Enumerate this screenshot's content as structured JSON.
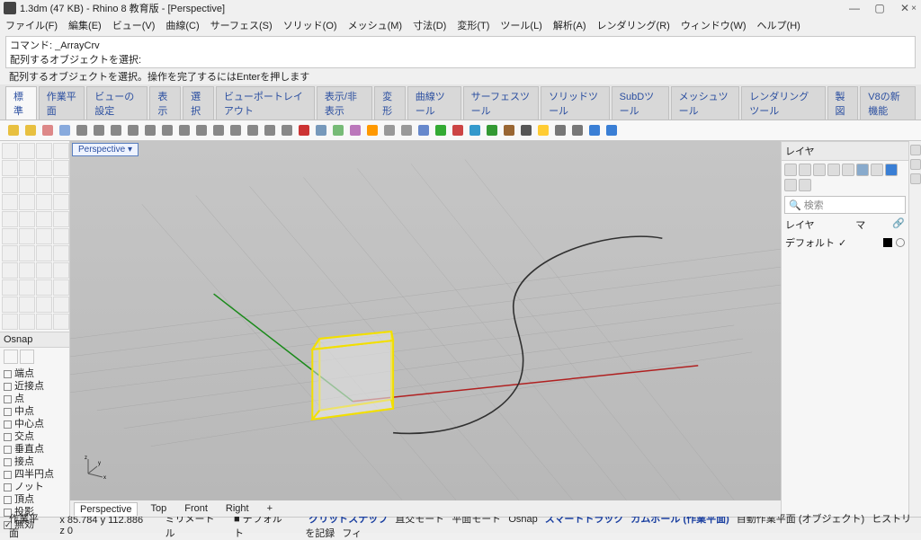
{
  "title": "1.3dm (47 KB) - Rhino 8 教育版 - [Perspective]",
  "menu": [
    "ファイル(F)",
    "編集(E)",
    "ビュー(V)",
    "曲線(C)",
    "サーフェス(S)",
    "ソリッド(O)",
    "メッシュ(M)",
    "寸法(D)",
    "変形(T)",
    "ツール(L)",
    "解析(A)",
    "レンダリング(R)",
    "ウィンドウ(W)",
    "ヘルプ(H)"
  ],
  "command_label": "コマンド:",
  "command_value": "_ArrayCrv",
  "history_line": "配列するオブジェクトを選択:",
  "prompt": "配列するオブジェクトを選択。操作を完了するにはEnterを押します",
  "ribbon_tabs": [
    "標準",
    "作業平面",
    "ビューの設定",
    "表示",
    "選択",
    "ビューポートレイアウト",
    "表示/非表示",
    "変形",
    "曲線ツール",
    "サーフェスツール",
    "ソリッドツール",
    "SubDツール",
    "メッシュツール",
    "レンダリングツール",
    "製図",
    "V8の新機能"
  ],
  "viewport_label": "Perspective ▾",
  "viewport_tabs": [
    "Perspective",
    "Top",
    "Front",
    "Right",
    "+"
  ],
  "osnap_title": "Osnap",
  "osnap": [
    {
      "label": "端点",
      "ck": false
    },
    {
      "label": "近接点",
      "ck": false
    },
    {
      "label": "点",
      "ck": false
    },
    {
      "label": "中点",
      "ck": false
    },
    {
      "label": "中心点",
      "ck": false
    },
    {
      "label": "交点",
      "ck": false
    },
    {
      "label": "垂直点",
      "ck": false
    },
    {
      "label": "接点",
      "ck": false
    },
    {
      "label": "四半円点",
      "ck": false
    },
    {
      "label": "ノット",
      "ck": false
    },
    {
      "label": "頂点",
      "ck": false
    },
    {
      "label": "投影",
      "ck": false
    },
    {
      "label": "無効",
      "ck": true
    }
  ],
  "right": {
    "panel_title": "レイヤ",
    "search_placeholder": "検索",
    "col_layer": "レイヤ",
    "col_mat": "マ",
    "default_layer": "デフォルト"
  },
  "status": {
    "cplane": "作業平面",
    "coords": "x 85.784  y 112.886  z 0",
    "units": "ミリメートル",
    "layer": "デフォルト",
    "items": [
      "グリッドスナップ",
      "直交モード",
      "平面モード",
      "Osnap",
      "スマートトラック",
      "ガムボール (作業平面)",
      "自動作業平面 (オブジェクト)",
      "ヒストリを記録",
      "フィ"
    ]
  },
  "chart_data": {
    "type": "scene",
    "objects": [
      {
        "kind": "box",
        "state": "selected",
        "wire_color": "#f5e400",
        "approx_size": "unit cube at origin"
      },
      {
        "kind": "curve",
        "state": "normal",
        "desc": "S-shaped planar curve on ground plane"
      }
    ],
    "axes": {
      "x": "red",
      "y": "green",
      "z": "blue"
    }
  }
}
